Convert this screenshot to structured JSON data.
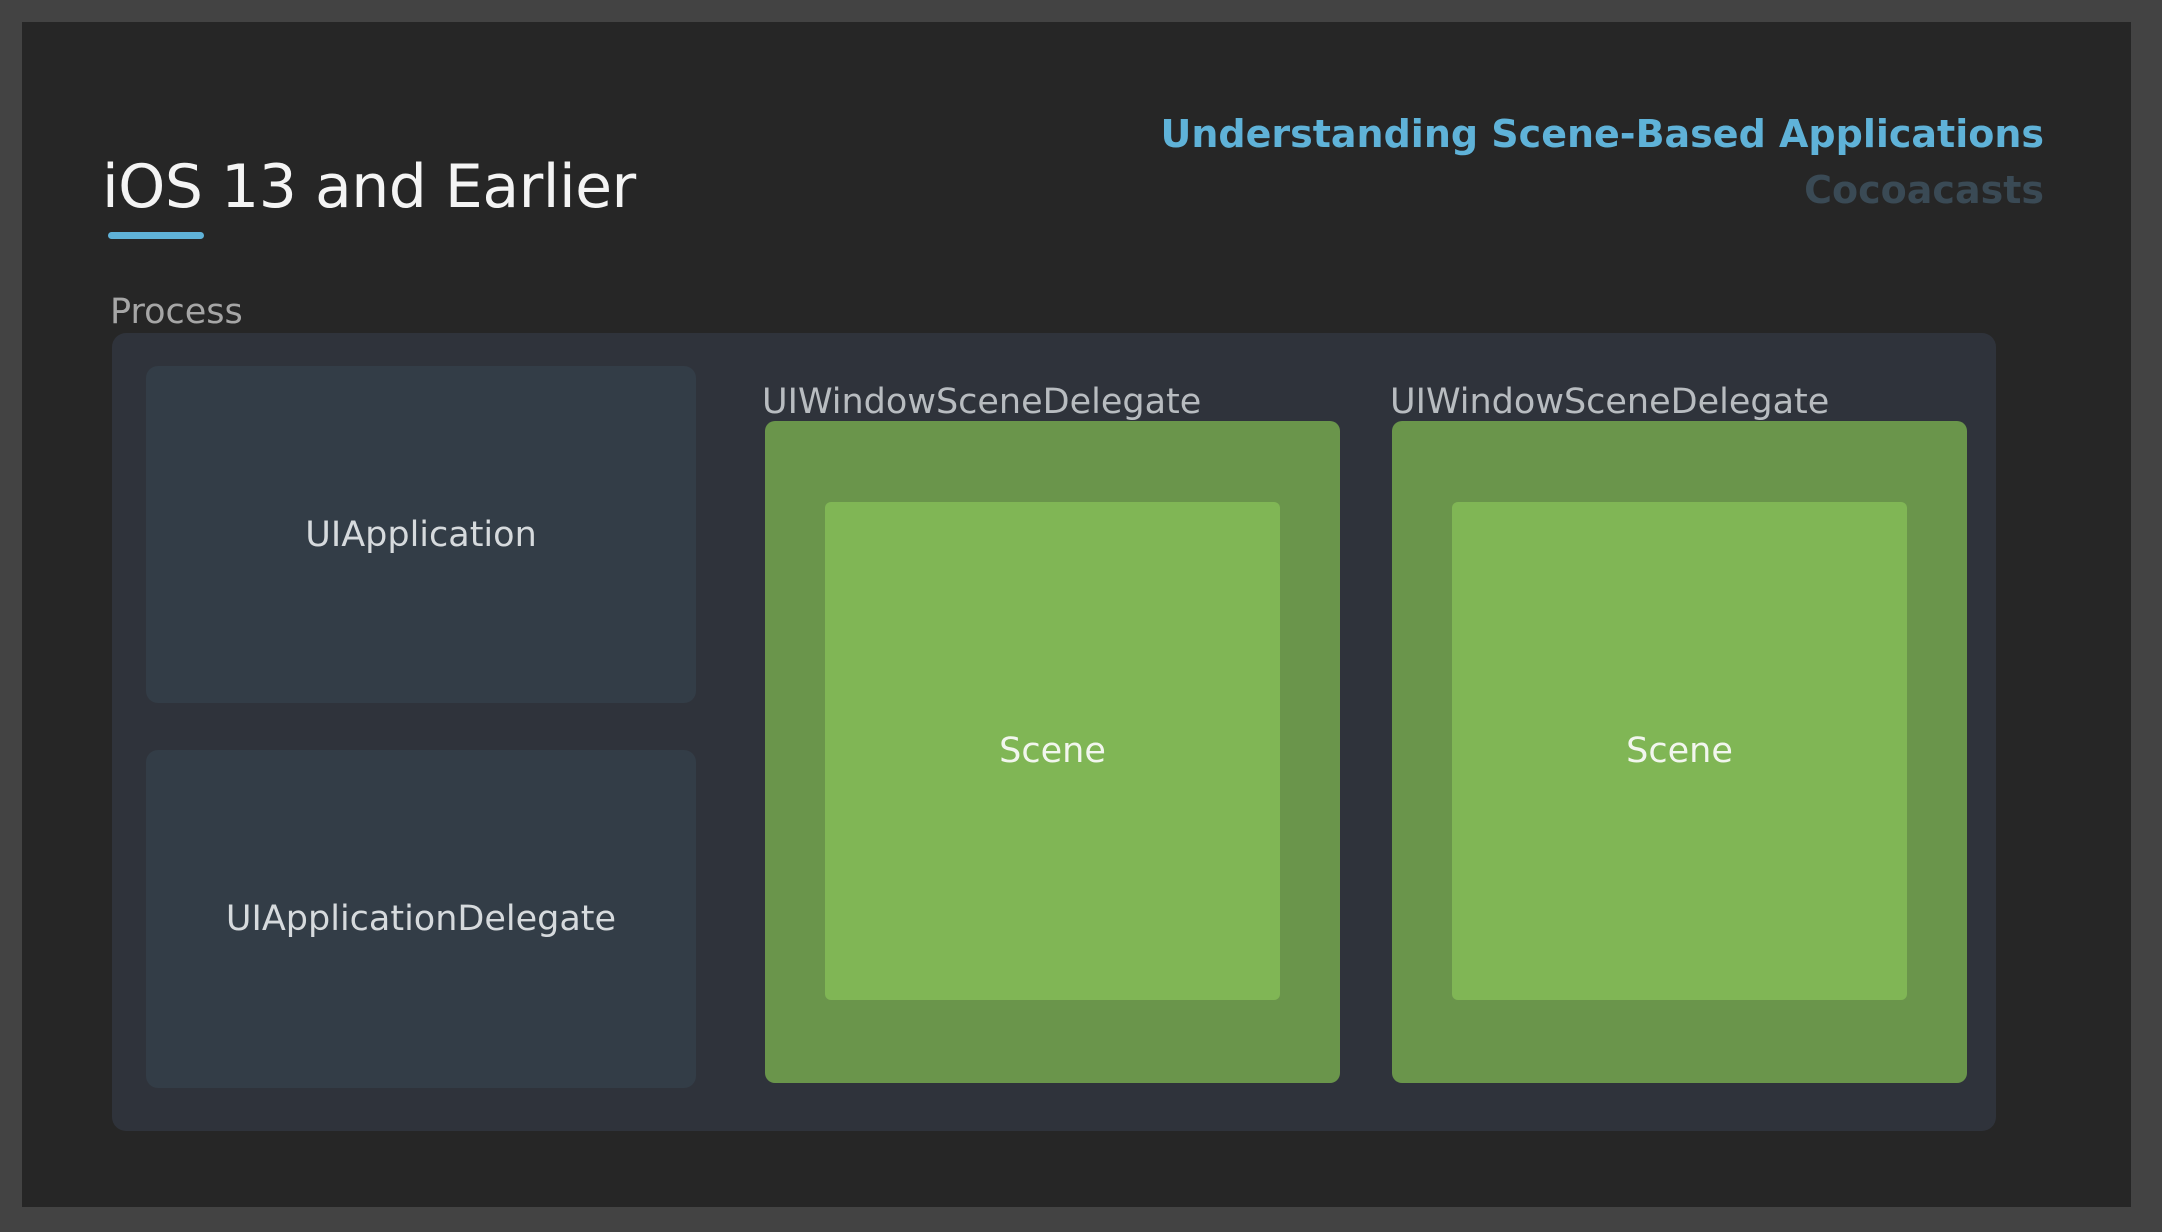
{
  "header": {
    "course_title": "Understanding Scene-Based Applications",
    "brand": "Cocoacasts"
  },
  "slide": {
    "title": "iOS 13 and Earlier",
    "process_label": "Process"
  },
  "diagram": {
    "app_boxes": [
      {
        "label": "UIApplication"
      },
      {
        "label": "UIApplicationDelegate"
      }
    ],
    "scene_delegates": [
      {
        "label": "UIWindowSceneDelegate",
        "scene_label": "Scene"
      },
      {
        "label": "UIWindowSceneDelegate",
        "scene_label": "Scene"
      }
    ]
  },
  "colors": {
    "accent": "#5fb2d8",
    "delegate_green": "#6a954b",
    "scene_green": "#80b655",
    "process_bg": "#2f333b",
    "app_box_bg": "#333d47"
  }
}
